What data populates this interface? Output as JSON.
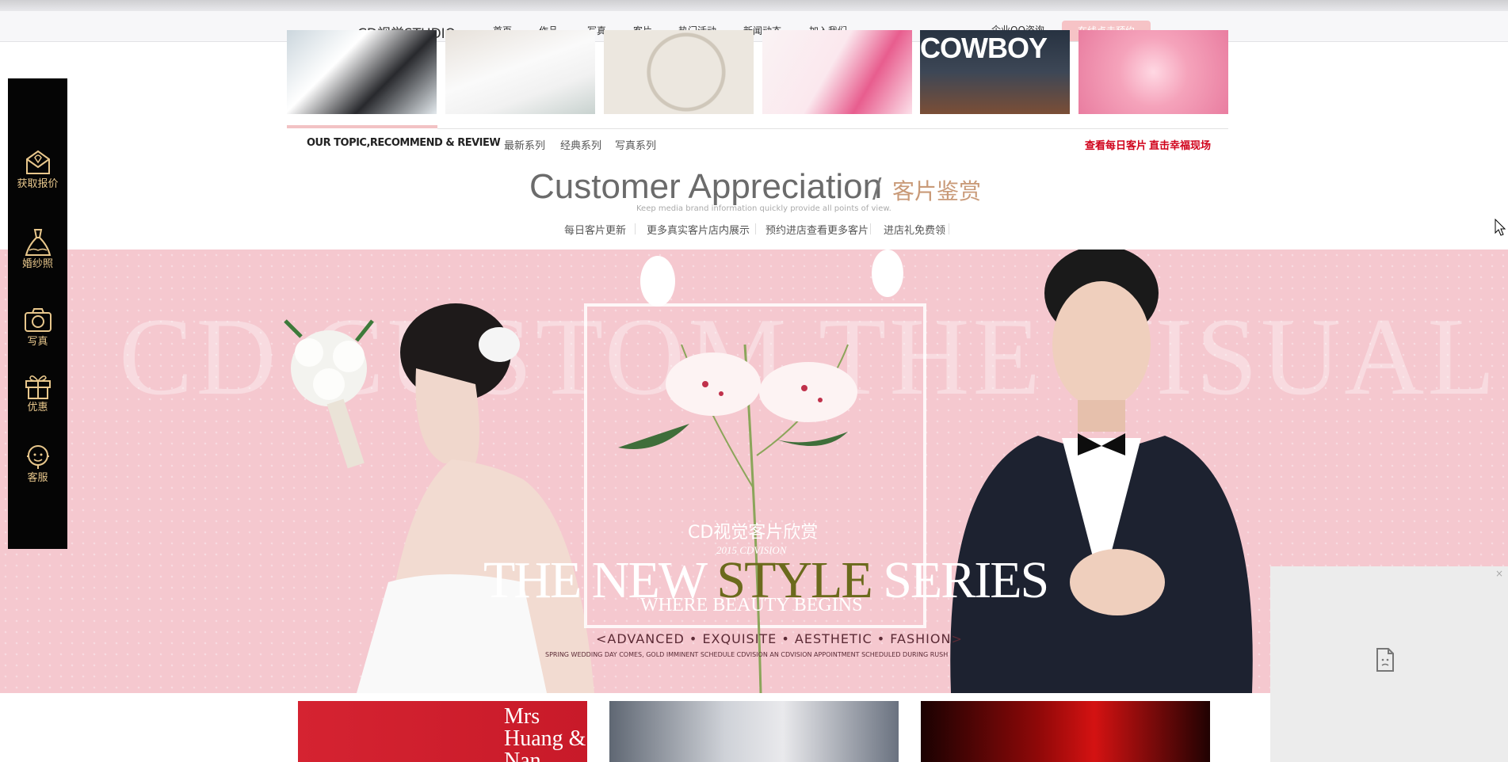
{
  "header": {
    "logo": "CD视觉STUDIO",
    "nav": [
      "首页",
      "作品",
      "写真",
      "客片",
      "热门活动",
      "新闻动态",
      "加入我们"
    ],
    "qq_link": "企业QQ咨询",
    "book_button": "在线点击预约"
  },
  "photo_strip": {
    "cowboy_text": "COWBOY"
  },
  "topic_bar": {
    "title": "OUR TOPIC,RECOMMEND & REVIEW",
    "tabs": [
      "最新系列",
      "经典系列",
      "写真系列"
    ],
    "link_daily": "查看每日客片",
    "link_live": "直击幸福现场"
  },
  "customer_section": {
    "title": "Customer Appreciation",
    "slash": "/",
    "title_cn": "客片鉴赏",
    "subtitle": "Keep media brand information quickly provide all points of view.",
    "tabs": [
      "每日客片更新",
      "更多真实客片店内展示",
      "预约进店查看更多客片",
      "进店礼免费领"
    ]
  },
  "banner": {
    "watermark": "CD CUSTOM THE VISUAL APPRECIATION",
    "title_cn": "CD视觉客片欣赏",
    "year": "2015 CDVISION",
    "style_pre": "THE NEW ",
    "style_accent": "STYLE",
    "style_post": " SERIES",
    "beauty": "WHERE BEAUTY BEGINS",
    "adv": "<ADVANCED • EXQUISITE • AESTHETIC • FASHION>",
    "spring": "SPRING WEDDING DAY COMES, GOLD IMMINENT SCHEDULE CDVISION AN CDVISION APPOINTMENT SCHEDULED DURING RUSH"
  },
  "sidebar": {
    "items": [
      {
        "label": "获取报价",
        "icon": "quote-envelope-icon"
      },
      {
        "label": "婚纱照",
        "icon": "wedding-dress-icon"
      },
      {
        "label": "写真",
        "icon": "camera-icon"
      },
      {
        "label": "优惠",
        "icon": "gift-icon"
      },
      {
        "label": "客服",
        "icon": "customer-service-icon"
      }
    ]
  },
  "thumbnails": {
    "huang_nan": "Mrs Huang & Nan"
  },
  "float_panel": {
    "close": "×"
  },
  "colors": {
    "accent_pink": "#f6c3c6",
    "link_red": "#d0021b",
    "gold": "#e8c78c",
    "banner_pink": "#f5c8cf"
  }
}
